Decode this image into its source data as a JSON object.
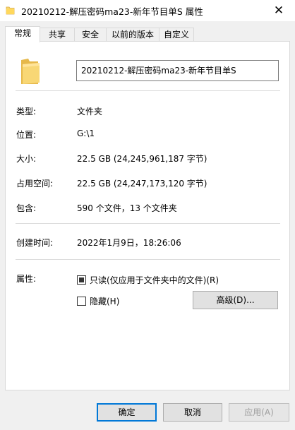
{
  "window": {
    "title": "20210212-解压密码ma23-新年节目单S 属性",
    "close_glyph": "✕"
  },
  "tabs": [
    {
      "label": "常规",
      "active": true
    },
    {
      "label": "共享",
      "active": false
    },
    {
      "label": "安全",
      "active": false
    },
    {
      "label": "以前的版本",
      "active": false
    },
    {
      "label": "自定义",
      "active": false
    }
  ],
  "general": {
    "name_value": "20210212-解压密码ma23-新年节目单S",
    "rows": [
      {
        "label": "类型:",
        "value": "文件夹"
      },
      {
        "label": "位置:",
        "value": "G:\\1"
      },
      {
        "label": "大小:",
        "value": "22.5 GB (24,245,961,187 字节)"
      },
      {
        "label": "占用空间:",
        "value": "22.5 GB (24,247,173,120 字节)"
      },
      {
        "label": "包含:",
        "value": "590 个文件，13 个文件夹"
      }
    ],
    "created_label": "创建时间:",
    "created_value": "2022年1月9日，18:26:06",
    "attributes_label": "属性:",
    "readonly_label": "只读(仅应用于文件夹中的文件)(R)",
    "readonly_state": "indeterminate",
    "hidden_label": "隐藏(H)",
    "hidden_checked": false,
    "advanced_button": "高级(D)..."
  },
  "footer": {
    "ok": "确定",
    "cancel": "取消",
    "apply": "应用(A)"
  },
  "colors": {
    "folder": "#f8d775",
    "accent": "#0078d7"
  },
  "icons": {
    "title_icon": "folder-icon",
    "main_icon": "folder-icon"
  }
}
